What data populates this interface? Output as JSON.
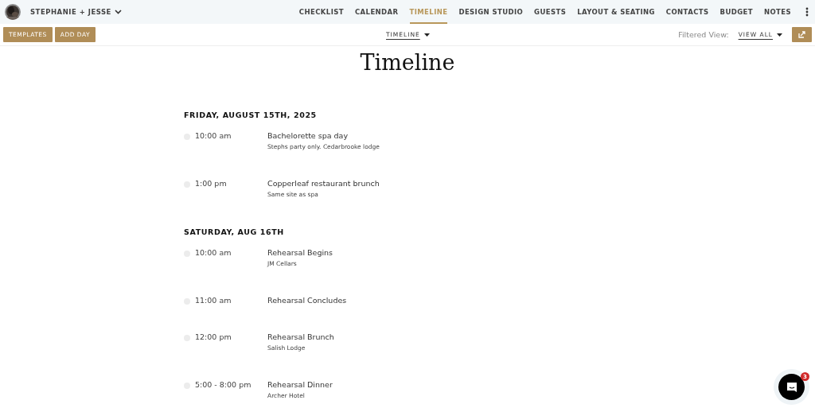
{
  "header": {
    "account": "STEPHANIE + JESSE"
  },
  "nav": [
    {
      "label": "CHECKLIST",
      "selected": false
    },
    {
      "label": "CALENDAR",
      "selected": false
    },
    {
      "label": "TIMELINE",
      "selected": true
    },
    {
      "label": "DESIGN STUDIO",
      "selected": false
    },
    {
      "label": "GUESTS",
      "selected": false
    },
    {
      "label": "LAYOUT & SEATING",
      "selected": false
    },
    {
      "label": "CONTACTS",
      "selected": false
    },
    {
      "label": "BUDGET",
      "selected": false
    },
    {
      "label": "NOTES",
      "selected": false
    }
  ],
  "toolbar": {
    "buttons": [
      "TEMPLATES",
      "ADD DAY"
    ],
    "view_select": "TIMELINE",
    "filter_label": "Filtered View:",
    "filter_value": "VIEW ALL"
  },
  "title": "Timeline",
  "days": [
    {
      "heading": "FRIDAY, AUGUST 15TH, 2025",
      "events": [
        {
          "time": "10:00 am",
          "title": "Bachelorette spa day",
          "note": "Stephs party only. Cedarbrooke lodge"
        },
        {
          "time": "1:00 pm",
          "title": "Copperleaf restaurant brunch",
          "note": "Same site as spa"
        }
      ]
    },
    {
      "heading": "SATURDAY, AUG 16TH",
      "events": [
        {
          "time": "10:00 am",
          "title": "Rehearsal Begins",
          "note": "JM Cellars"
        },
        {
          "time": "11:00 am",
          "title": "Rehearsal Concludes"
        },
        {
          "time": "12:00 pm",
          "title": "Rehearsal Brunch",
          "note": "Salish Lodge"
        },
        {
          "time": "5:00 - 8:00 pm",
          "title": "Rehearsal Dinner",
          "note": "Archer Hotel"
        }
      ]
    }
  ],
  "chat": {
    "badge": "3"
  }
}
